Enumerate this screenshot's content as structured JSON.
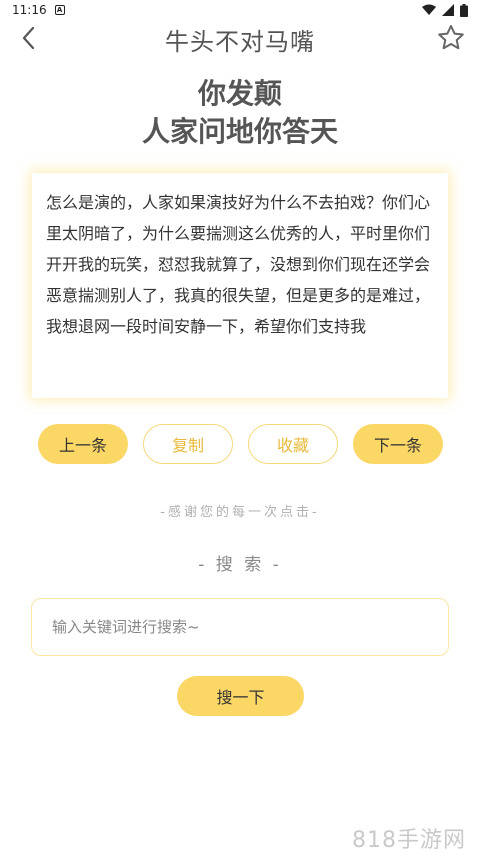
{
  "status_bar": {
    "time": "11:16",
    "notification_icon": "a-badge-icon",
    "icons": [
      "wifi-icon",
      "signal-icon",
      "battery-icon"
    ]
  },
  "app_bar": {
    "title": "牛头不对马嘴",
    "back_icon": "chevron-left-icon",
    "favorite_icon": "star-outline-icon"
  },
  "riddle": {
    "line1": "你发颠",
    "line2": "人家问地你答天"
  },
  "answer": {
    "text": "怎么是演的，人家如果演技好为什么不去拍戏？你们心里太阴暗了，为什么要揣测这么优秀的人，平时里你们开开我的玩笑，怼怼我就算了，没想到你们现在还学会恶意揣测别人了，我真的很失望，但是更多的是难过，我想退网一段时间安静一下，希望你们支持我"
  },
  "actions": {
    "prev": "上一条",
    "copy": "复制",
    "favorite": "收藏",
    "next": "下一条"
  },
  "thanks_text": "-感谢您的每一次点击-",
  "search": {
    "heading": "- 搜 索 -",
    "placeholder": "输入关键词进行搜索~",
    "button": "搜一下"
  },
  "watermark": "818手游网",
  "colors": {
    "accent": "#fbd766",
    "accent_text": "#e8b93a",
    "card_glow": "#fae06e"
  }
}
